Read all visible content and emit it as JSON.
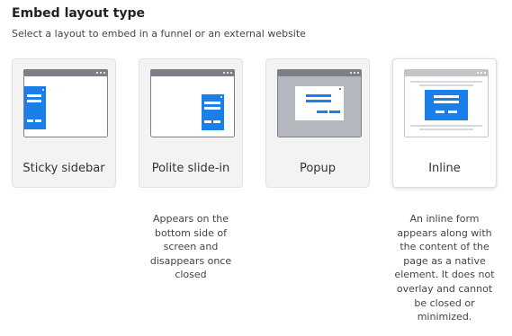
{
  "header": {
    "title": "Embed layout type",
    "subtitle": "Select a layout to embed in a funnel or an external website"
  },
  "layouts": [
    {
      "label": "Sticky sidebar",
      "description": ""
    },
    {
      "label": "Polite slide-in",
      "description": "Appears on the bottom side of screen and disappears once closed"
    },
    {
      "label": "Popup",
      "description": ""
    },
    {
      "label": "Inline",
      "description": "An inline form appears along with the content of the page as a native element. It does not overlay and cannot be closed or minimized."
    }
  ],
  "selected_layout": "Inline",
  "colors": {
    "accent": "#1a7fe8",
    "window_frame": "#7b7f87",
    "card_bg": "#f3f3f3",
    "selected_card_bg": "#ffffff"
  }
}
